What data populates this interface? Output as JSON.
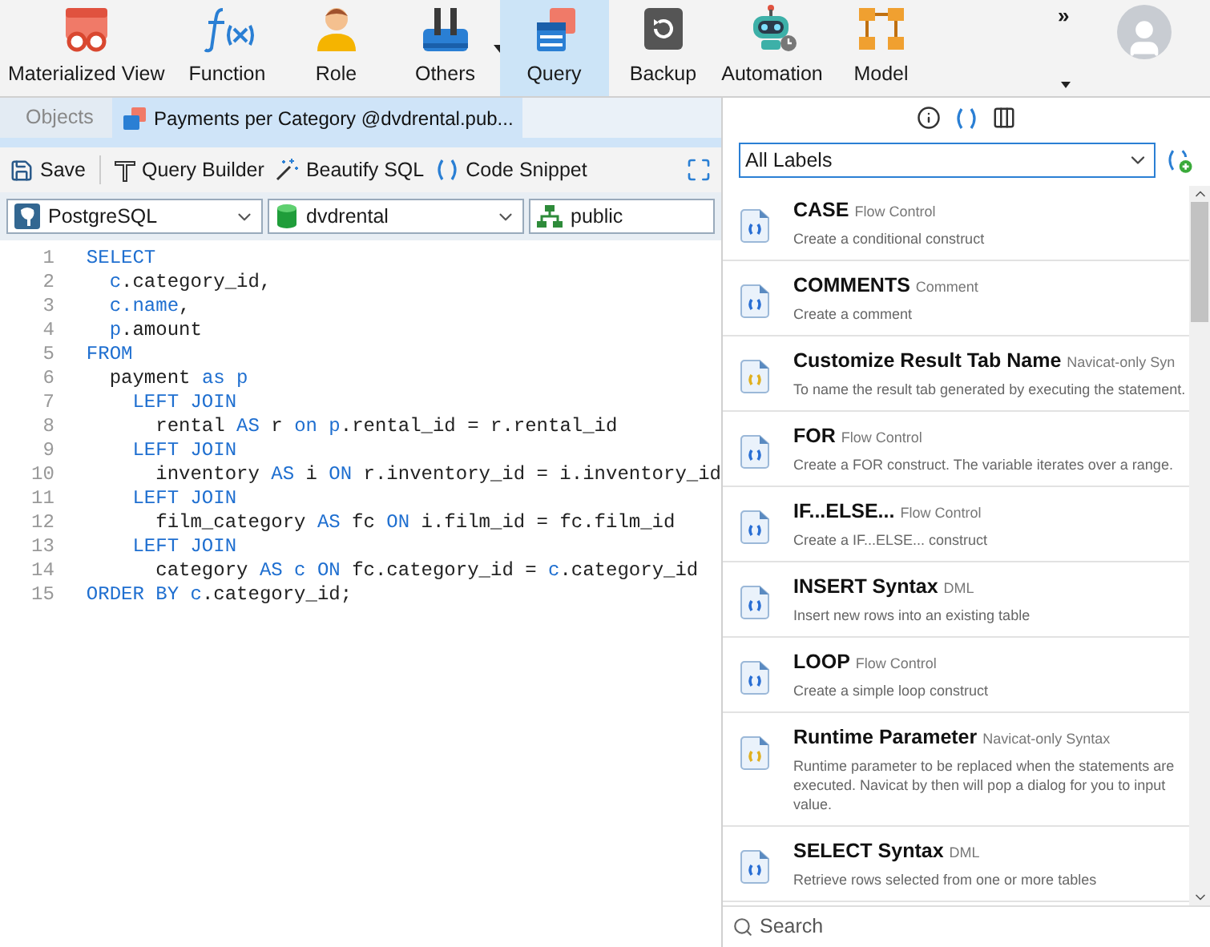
{
  "toolbar": [
    {
      "label": "Materialized View",
      "selected": false,
      "menu": false
    },
    {
      "label": "Function",
      "selected": false,
      "menu": false
    },
    {
      "label": "Role",
      "selected": false,
      "menu": false
    },
    {
      "label": "Others",
      "selected": false,
      "menu": true
    },
    {
      "label": "Query",
      "selected": true,
      "menu": false
    },
    {
      "label": "Backup",
      "selected": false,
      "menu": false
    },
    {
      "label": "Automation",
      "selected": false,
      "menu": false
    },
    {
      "label": "Model",
      "selected": false,
      "menu": false
    }
  ],
  "overflow": "»",
  "tabs": [
    {
      "label": "Objects",
      "selected": false
    },
    {
      "label": "Payments per Category @dvdrental.pub...",
      "selected": true
    }
  ],
  "editor_toolbar": [
    {
      "label": "Save"
    },
    {
      "label": "Query Builder"
    },
    {
      "label": "Beautify SQL"
    },
    {
      "label": "Code Snippet"
    }
  ],
  "selectors": [
    {
      "value": "PostgreSQL",
      "dropdown": true
    },
    {
      "value": "dvdrental",
      "dropdown": true
    },
    {
      "value": "public",
      "dropdown": false
    }
  ],
  "code": [
    {
      "number": "1",
      "segments": [
        {
          "text": "SELECT",
          "kind": "kw"
        }
      ]
    },
    {
      "number": "2",
      "segments": [
        {
          "text": "  c",
          "kind": "kw"
        },
        {
          "text": ".category_id,",
          "kind": "id"
        }
      ]
    },
    {
      "number": "3",
      "segments": [
        {
          "text": "  c.name",
          "kind": "kw"
        },
        {
          "text": ",",
          "kind": "id"
        }
      ]
    },
    {
      "number": "4",
      "segments": [
        {
          "text": "  p",
          "kind": "kw"
        },
        {
          "text": ".amount",
          "kind": "id"
        }
      ]
    },
    {
      "number": "5",
      "segments": [
        {
          "text": "FROM",
          "kind": "kw"
        }
      ]
    },
    {
      "number": "6",
      "segments": [
        {
          "text": "  payment ",
          "kind": "id"
        },
        {
          "text": "as p",
          "kind": "kw"
        }
      ]
    },
    {
      "number": "7",
      "segments": [
        {
          "text": "    LEFT JOIN",
          "kind": "kw"
        }
      ]
    },
    {
      "number": "8",
      "segments": [
        {
          "text": "      rental ",
          "kind": "id"
        },
        {
          "text": "AS",
          "kind": "kw"
        },
        {
          "text": " r ",
          "kind": "id"
        },
        {
          "text": "on p",
          "kind": "kw"
        },
        {
          "text": ".rental_id = r.rental_id",
          "kind": "id"
        }
      ]
    },
    {
      "number": "9",
      "segments": [
        {
          "text": "    LEFT JOIN",
          "kind": "kw"
        }
      ]
    },
    {
      "number": "10",
      "segments": [
        {
          "text": "      inventory ",
          "kind": "id"
        },
        {
          "text": "AS",
          "kind": "kw"
        },
        {
          "text": " i ",
          "kind": "id"
        },
        {
          "text": "ON",
          "kind": "kw"
        },
        {
          "text": " r.inventory_id = i.inventory_id",
          "kind": "id"
        }
      ]
    },
    {
      "number": "11",
      "segments": [
        {
          "text": "    LEFT JOIN",
          "kind": "kw"
        }
      ]
    },
    {
      "number": "12",
      "segments": [
        {
          "text": "      film_category ",
          "kind": "id"
        },
        {
          "text": "AS",
          "kind": "kw"
        },
        {
          "text": " fc ",
          "kind": "id"
        },
        {
          "text": "ON",
          "kind": "kw"
        },
        {
          "text": " i.film_id = fc.film_id",
          "kind": "id"
        }
      ]
    },
    {
      "number": "13",
      "segments": [
        {
          "text": "    LEFT JOIN",
          "kind": "kw"
        }
      ]
    },
    {
      "number": "14",
      "segments": [
        {
          "text": "      category ",
          "kind": "id"
        },
        {
          "text": "AS c ON",
          "kind": "kw"
        },
        {
          "text": " fc.category_id = ",
          "kind": "id"
        },
        {
          "text": "c",
          "kind": "kw"
        },
        {
          "text": ".category_id",
          "kind": "id"
        }
      ]
    },
    {
      "number": "15",
      "segments": [
        {
          "text": "ORDER BY c",
          "kind": "kw"
        },
        {
          "text": ".category_id;",
          "kind": "id"
        }
      ]
    }
  ],
  "snippet_panel": {
    "label_filter": "All Labels",
    "search_placeholder": "Search",
    "snippets": [
      {
        "title": "CASE",
        "tag": "Flow Control",
        "description": "Create a conditional construct",
        "kind": "standard"
      },
      {
        "title": "COMMENTS",
        "tag": "Comment",
        "description": "Create a comment",
        "kind": "standard"
      },
      {
        "title": "Customize Result Tab Name",
        "tag": "Navicat-only Syn",
        "description": "To name the result tab generated by executing the statement.",
        "kind": "navicat"
      },
      {
        "title": "FOR",
        "tag": "Flow Control",
        "description": "Create a FOR construct. The variable iterates over a range.",
        "kind": "standard"
      },
      {
        "title": "IF...ELSE...",
        "tag": "Flow Control",
        "description": "Create a IF...ELSE... construct",
        "kind": "standard"
      },
      {
        "title": "INSERT Syntax",
        "tag": "DML",
        "description": "Insert new rows into an existing table",
        "kind": "standard"
      },
      {
        "title": "LOOP",
        "tag": "Flow Control",
        "description": "Create a simple loop construct",
        "kind": "standard"
      },
      {
        "title": "Runtime Parameter",
        "tag": "Navicat-only Syntax",
        "description": "Runtime parameter to be replaced when the statements are executed. Navicat by then will pop a dialog for you to input value.",
        "kind": "navicat"
      },
      {
        "title": "SELECT Syntax",
        "tag": "DML",
        "description": "Retrieve rows selected from one or more tables",
        "kind": "standard"
      }
    ]
  }
}
